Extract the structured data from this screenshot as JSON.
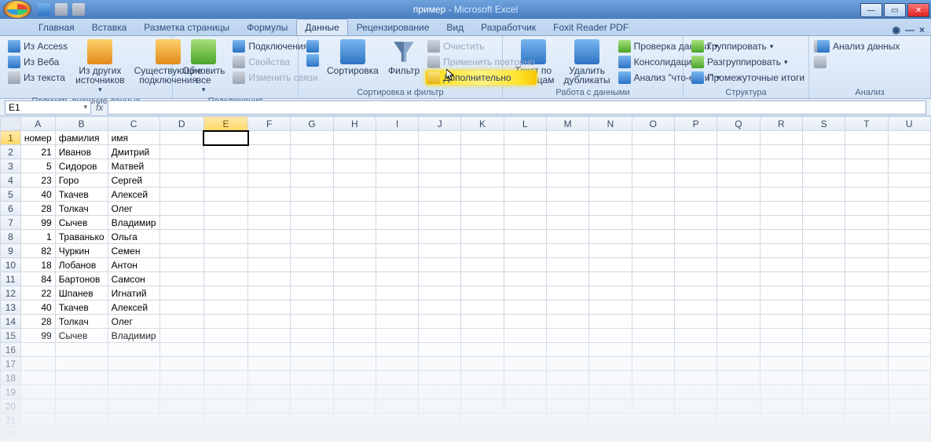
{
  "title": {
    "doc": "пример",
    "app": "Microsoft Excel"
  },
  "qat_icons": [
    "save-icon",
    "undo-icon",
    "redo-icon"
  ],
  "tabs": [
    "Главная",
    "Вставка",
    "Разметка страницы",
    "Формулы",
    "Данные",
    "Рецензирование",
    "Вид",
    "Разработчик",
    "Foxit Reader PDF"
  ],
  "active_tab": 4,
  "ribbon": {
    "groups": [
      {
        "name": "get-external",
        "label": "Получить внешние данные",
        "items": {
          "access": "Из Access",
          "web": "Из Веба",
          "text": "Из текста",
          "other": "Из других источников",
          "existing": "Существующие подключения"
        }
      },
      {
        "name": "connections",
        "label": "Подключения",
        "items": {
          "refresh": "Обновить все",
          "conns": "Подключения",
          "props": "Свойства",
          "editlinks": "Изменить связи"
        }
      },
      {
        "name": "sortfilter",
        "label": "Сортировка и фильтр",
        "items": {
          "az": "А↓Я",
          "za": "Я↓А",
          "sort": "Сортировка",
          "filter": "Фильтр",
          "clear": "Очистить",
          "reapply": "Применить повторно",
          "advanced": "Дополнительно"
        }
      },
      {
        "name": "datatools",
        "label": "Работа с данными",
        "items": {
          "t2c": "Текст по столбцам",
          "dedup": "Удалить дубликаты",
          "validate": "Проверка данных",
          "consolidate": "Консолидация",
          "whatif": "Анализ \"что-если\""
        }
      },
      {
        "name": "outline",
        "label": "Структура",
        "items": {
          "group": "Группировать",
          "ungroup": "Разгруппировать",
          "subtotal": "Промежуточные итоги"
        }
      },
      {
        "name": "analysis",
        "label": "Анализ",
        "items": {
          "analyze": "Анализ данных"
        }
      }
    ]
  },
  "namebox": "E1",
  "fx_label": "fx",
  "columns": [
    "A",
    "B",
    "C",
    "D",
    "E",
    "F",
    "G",
    "H",
    "I",
    "J",
    "K",
    "L",
    "M",
    "N",
    "O",
    "P",
    "Q",
    "R",
    "S",
    "T",
    "U"
  ],
  "selected_cell": {
    "row": 1,
    "col": "E"
  },
  "headers": {
    "A": "номер",
    "B": "фамилия",
    "C": "имя"
  },
  "rows": [
    {
      "n": 1,
      "A": "номер",
      "B": "фамилия",
      "C": "имя"
    },
    {
      "n": 2,
      "A": "21",
      "B": "Иванов",
      "C": "Дмитрий"
    },
    {
      "n": 3,
      "A": "5",
      "B": "Сидоров",
      "C": "Матвей"
    },
    {
      "n": 4,
      "A": "23",
      "B": "Горо",
      "C": "Сергей"
    },
    {
      "n": 5,
      "A": "40",
      "B": "Ткачев",
      "C": "Алексей"
    },
    {
      "n": 6,
      "A": "28",
      "B": "Толкач",
      "C": "Олег"
    },
    {
      "n": 7,
      "A": "99",
      "B": "Сычев",
      "C": "Владимир"
    },
    {
      "n": 8,
      "A": "1",
      "B": "Траванько",
      "C": "Ольга"
    },
    {
      "n": 9,
      "A": "82",
      "B": "Чуркин",
      "C": "Семен"
    },
    {
      "n": 10,
      "A": "18",
      "B": "Лобанов",
      "C": "Антон"
    },
    {
      "n": 11,
      "A": "84",
      "B": "Бартонов",
      "C": "Самсон"
    },
    {
      "n": 12,
      "A": "22",
      "B": "Шпанев",
      "C": "Игнатий"
    },
    {
      "n": 13,
      "A": "40",
      "B": "Ткачев",
      "C": "Алексей"
    },
    {
      "n": 14,
      "A": "28",
      "B": "Толкач",
      "C": "Олег"
    },
    {
      "n": 15,
      "A": "99",
      "B": "Сычев",
      "C": "Владимир"
    }
  ],
  "visible_row_count": 22
}
